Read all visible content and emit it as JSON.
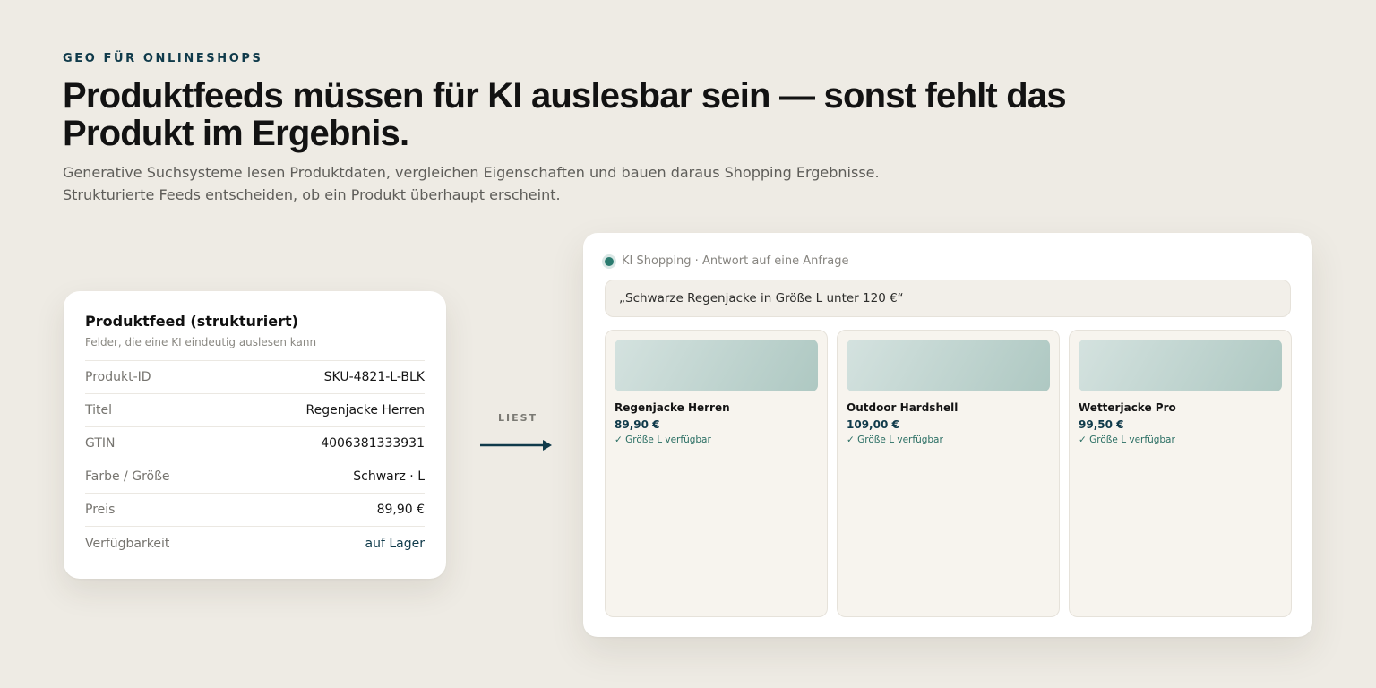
{
  "header": {
    "eyebrow": "GEO FÜR ONLINESHOPS",
    "headline": "Produktfeeds müssen für KI auslesbar sein — sonst fehlt das Produkt im Ergebnis.",
    "lede": "Generative Suchsysteme lesen Produktdaten, vergleichen Eigenschaften und bauen daraus Shopping Ergebnisse. Strukturierte Feeds entscheiden, ob ein Produkt überhaupt erscheint."
  },
  "feed": {
    "title": "Produktfeed (strukturiert)",
    "subtitle": "Felder, die eine KI eindeutig auslesen kann",
    "rows": [
      {
        "label": "Produkt-ID",
        "value": "SKU-4821-L-BLK"
      },
      {
        "label": "Titel",
        "value": "Regenjacke Herren"
      },
      {
        "label": "GTIN",
        "value": "4006381333931"
      },
      {
        "label": "Farbe / Größe",
        "value": "Schwarz · L"
      },
      {
        "label": "Preis",
        "value": "89,90 €"
      },
      {
        "label": "Verfügbarkeit",
        "value": "auf Lager"
      }
    ]
  },
  "connector": {
    "label": "LIEST",
    "icon": "arrow-right-icon"
  },
  "ai_panel": {
    "header": "KI Shopping · Antwort auf eine Anfrage",
    "query": "„Schwarze Regenjacke in Größe L unter 120 €“",
    "results": [
      {
        "name": "Regenjacke Herren",
        "price": "89,90 €",
        "stock": "✓ Größe L verfügbar"
      },
      {
        "name": "Outdoor Hardshell",
        "price": "109,00 €",
        "stock": "✓ Größe L verfügbar"
      },
      {
        "name": "Wetterjacke Pro",
        "price": "99,50 €",
        "stock": "✓ Größe L verfügbar"
      }
    ]
  },
  "colors": {
    "background": "#eeebe4",
    "accent": "#0f3a4a",
    "status_green": "#2a7b6f"
  }
}
